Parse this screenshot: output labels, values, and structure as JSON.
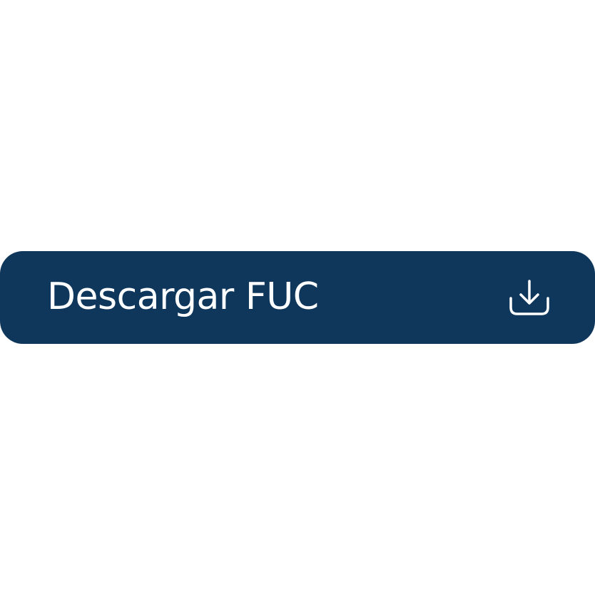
{
  "button": {
    "label": "Descargar FUC",
    "icon": "download-icon",
    "background_color": "#0f375c",
    "text_color": "#ffffff"
  }
}
